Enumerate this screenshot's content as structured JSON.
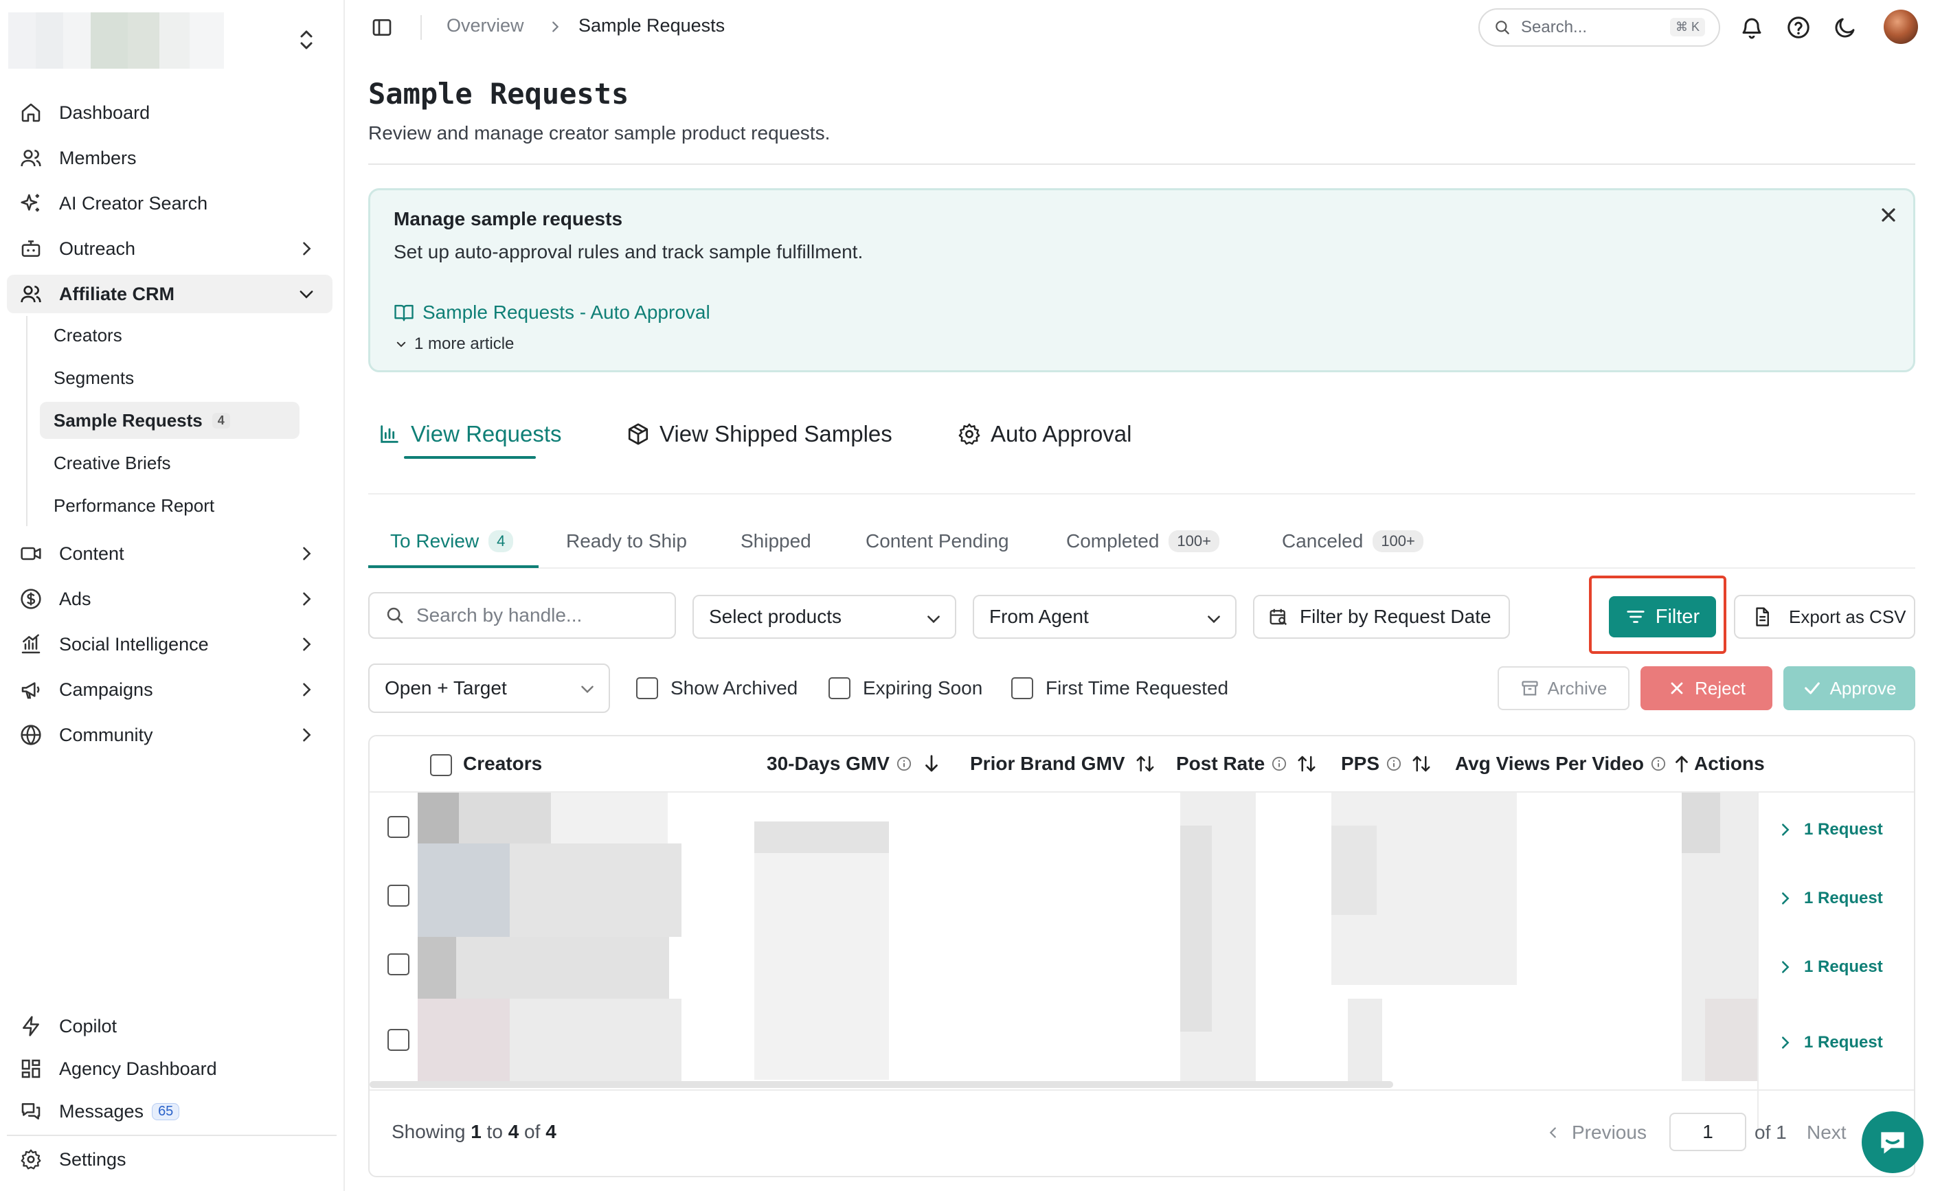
{
  "sidebar": {
    "nav_top": [
      {
        "label": "Dashboard",
        "icon": "home-icon"
      },
      {
        "label": "Members",
        "icon": "users-icon"
      },
      {
        "label": "AI Creator Search",
        "icon": "sparkles-icon"
      },
      {
        "label": "Outreach",
        "icon": "bot-icon"
      },
      {
        "label": "Affiliate CRM",
        "icon": "users-icon"
      }
    ],
    "crm_sub": [
      {
        "label": "Creators"
      },
      {
        "label": "Segments"
      },
      {
        "label": "Sample Requests",
        "badge": "4"
      },
      {
        "label": "Creative Briefs"
      },
      {
        "label": "Performance Report"
      }
    ],
    "nav_mid": [
      {
        "label": "Content",
        "icon": "video-icon"
      },
      {
        "label": "Ads",
        "icon": "dollar-icon"
      },
      {
        "label": "Social Intelligence",
        "icon": "chart-icon"
      },
      {
        "label": "Campaigns",
        "icon": "megaphone-icon"
      },
      {
        "label": "Community",
        "icon": "globe-icon"
      }
    ],
    "nav_bottom": [
      {
        "label": "Copilot",
        "icon": "zap-icon"
      },
      {
        "label": "Agency Dashboard",
        "icon": "dashboard-icon"
      },
      {
        "label": "Messages",
        "icon": "messages-icon",
        "badge": "65"
      },
      {
        "label": "Settings",
        "icon": "gear-icon"
      }
    ]
  },
  "topbar": {
    "breadcrumb": [
      "Overview",
      "Sample Requests"
    ],
    "search_placeholder": "Search...",
    "search_shortcut": "⌘ K"
  },
  "header": {
    "title": "Sample Requests",
    "subtitle": "Review and manage creator sample product requests."
  },
  "banner": {
    "title": "Manage sample requests",
    "text": "Set up auto-approval rules and track sample fulfillment.",
    "link": "Sample Requests - Auto Approval",
    "more": "1 more article"
  },
  "main_tabs": [
    {
      "label": "View Requests",
      "icon": "bar-chart-icon"
    },
    {
      "label": "View Shipped Samples",
      "icon": "package-icon"
    },
    {
      "label": "Auto Approval",
      "icon": "gear-icon"
    }
  ],
  "status_tabs": [
    {
      "label": "To Review",
      "badge": "4"
    },
    {
      "label": "Ready to Ship",
      "badge": ""
    },
    {
      "label": "Shipped",
      "badge": ""
    },
    {
      "label": "Content Pending",
      "badge": ""
    },
    {
      "label": "Completed",
      "badge": "100+"
    },
    {
      "label": "Canceled",
      "badge": "100+"
    }
  ],
  "toolbar": {
    "search_placeholder": "Search by handle...",
    "products_placeholder": "Select products",
    "agent_value": "From Agent",
    "date_filter": "Filter by Request Date",
    "filter": "Filter",
    "export": "Export as CSV",
    "status_value": "Open + Target",
    "show_archived": "Show Archived",
    "expiring_soon": "Expiring Soon",
    "first_time": "First Time Requested",
    "archive": "Archive",
    "reject": "Reject",
    "approve": "Approve"
  },
  "table": {
    "columns": [
      "Creators",
      "30-Days GMV",
      "Prior Brand GMV",
      "Post Rate",
      "PPS",
      "Avg Views Per Video",
      "Actions"
    ],
    "rows": [
      {
        "action": "1 Request"
      },
      {
        "action": "1 Request"
      },
      {
        "action": "1 Request"
      },
      {
        "action": "1 Request"
      }
    ],
    "footer": {
      "prefix": "Showing",
      "from": "1",
      "to_word": "to",
      "to": "4",
      "of_word": "of",
      "total": "4"
    },
    "pager": {
      "previous": "Previous",
      "page": "1",
      "of": "of 1",
      "next": "Next"
    }
  },
  "colors": {
    "accent": "#0f8c80",
    "reject": "#ea7b7b",
    "approve": "#8fd0c8",
    "highlight": "#e5422b"
  }
}
